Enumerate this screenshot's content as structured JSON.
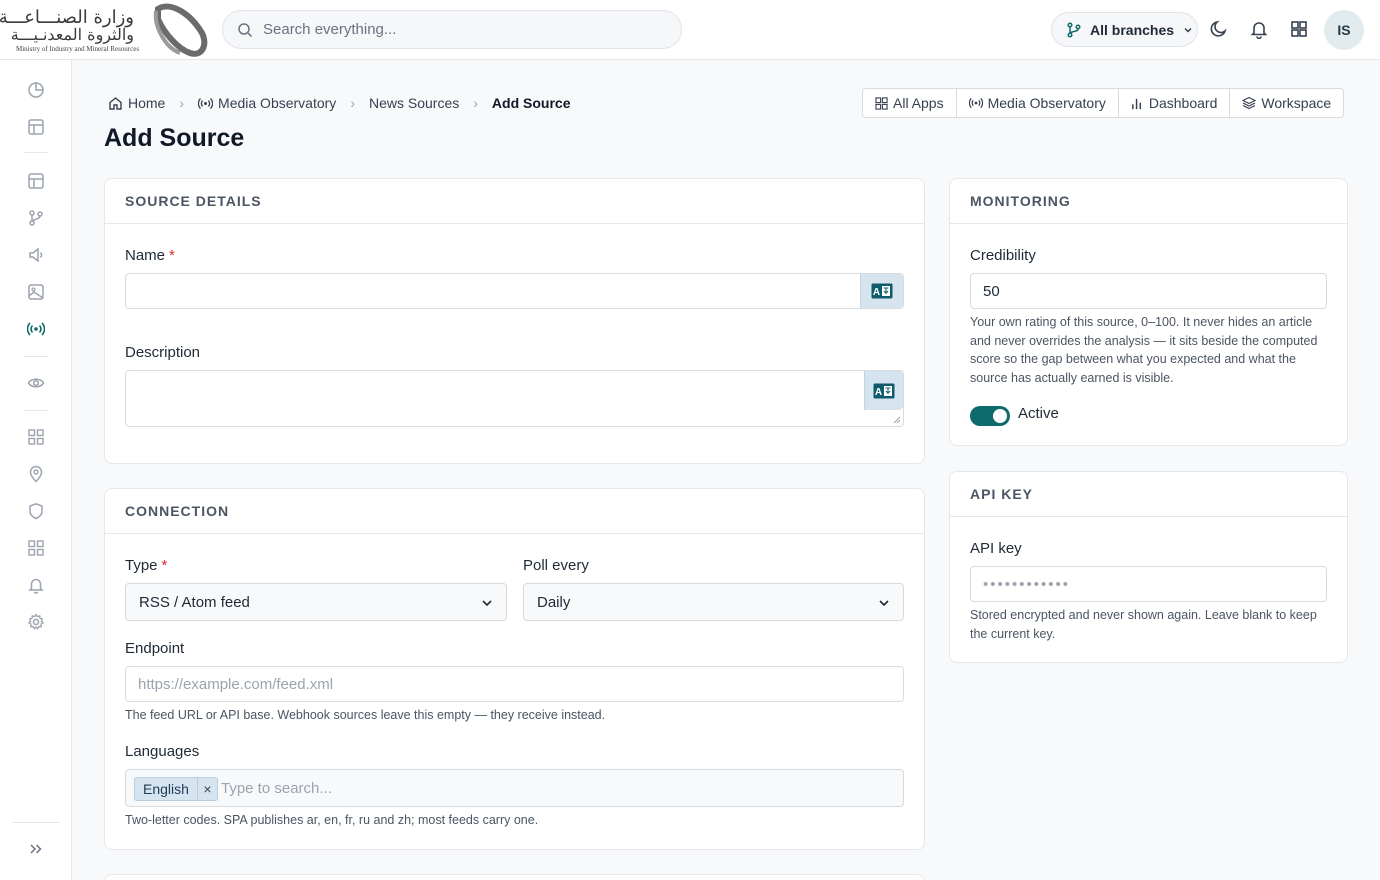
{
  "brand": {
    "arabic_line1": "وزارة الصنـــاعـــة",
    "arabic_line2": "والثروة المعدنـيـــة",
    "english": "Ministry of Industry and Mineral Resources"
  },
  "header": {
    "search_placeholder": "Search everything...",
    "branch_label": "All branches",
    "avatar_initials": "IS"
  },
  "breadcrumb": [
    {
      "label": "Home",
      "icon": "home-icon"
    },
    {
      "label": "Media Observatory",
      "icon": "broadcast-icon"
    },
    {
      "label": "News Sources"
    },
    {
      "label": "Add Source"
    }
  ],
  "quick_links": [
    {
      "label": "All Apps",
      "icon": "grid-icon"
    },
    {
      "label": "Media Observatory",
      "icon": "broadcast-icon"
    },
    {
      "label": "Dashboard",
      "icon": "bar-chart-icon"
    },
    {
      "label": "Workspace",
      "icon": "layers-icon"
    }
  ],
  "page_title": "Add Source",
  "source_details": {
    "title": "SOURCE DETAILS",
    "name_label": "Name",
    "name_value": "",
    "description_label": "Description",
    "description_value": "",
    "required_mark": "*"
  },
  "connection": {
    "title": "CONNECTION",
    "type_label": "Type",
    "type_value": "RSS / Atom feed",
    "poll_label": "Poll every",
    "poll_value": "Daily",
    "endpoint_label": "Endpoint",
    "endpoint_placeholder": "https://example.com/feed.xml",
    "endpoint_help": "The feed URL or API base. Webhook sources leave this empty — they receive instead.",
    "languages_label": "Languages",
    "language_chip": "English",
    "chip_remove": "×",
    "languages_placeholder": "Type to search...",
    "languages_help": "Two-letter codes. SPA publishes ar, en, fr, ru and zh; most feeds carry one."
  },
  "monitoring": {
    "title": "MONITORING",
    "credibility_label": "Credibility",
    "credibility_value": "50",
    "credibility_help": "Your own rating of this source, 0–100. It never hides an article and never overrides the analysis — it sits beside the computed score so the gap between what you expected and what the source has actually earned is visible.",
    "active_label": "Active",
    "active_on": true
  },
  "api_key": {
    "title": "API KEY",
    "label": "API key",
    "placeholder": "••••••••••••",
    "help": "Stored encrypted and never shown again. Leave blank to keep the current key."
  },
  "colors": {
    "accent": "#0f6b6b",
    "chip_bg": "#d6e4f0",
    "required": "#dc2626"
  }
}
